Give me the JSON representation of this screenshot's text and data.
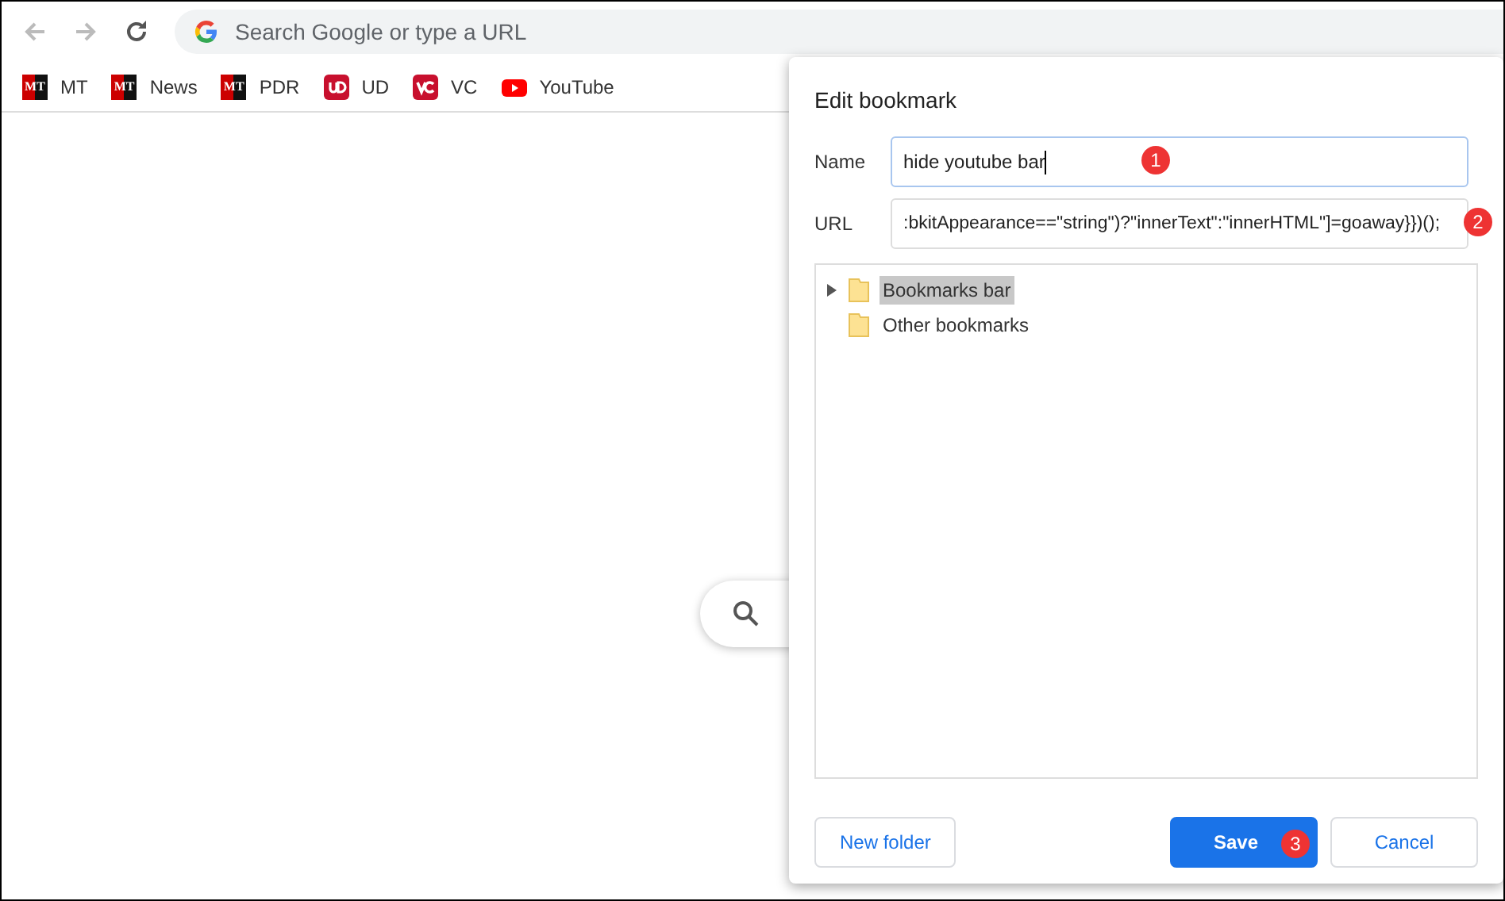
{
  "toolbar": {
    "address_placeholder": "Search Google or type a URL"
  },
  "bookmarks": [
    {
      "label": "MT",
      "kind": "mt",
      "icon_text": "MT"
    },
    {
      "label": "News",
      "kind": "mt",
      "icon_text": "MT"
    },
    {
      "label": "PDR",
      "kind": "mt",
      "icon_text": "MT"
    },
    {
      "label": "UD",
      "kind": "ud"
    },
    {
      "label": "VC",
      "kind": "vc"
    },
    {
      "label": "YouTube",
      "kind": "yt"
    }
  ],
  "dialog": {
    "title": "Edit bookmark",
    "fields": [
      {
        "label": "Name",
        "value": "hide youtube bar",
        "focused": true,
        "marker": "1"
      },
      {
        "label": "URL",
        "value": ":bkitAppearance==\"string\")?\"innerText\":\"innerHTML\"]=goaway}})();",
        "focused": false,
        "marker": "2"
      }
    ],
    "folders": [
      {
        "label": "Bookmarks bar",
        "selected": true,
        "expandable": true
      },
      {
        "label": "Other bookmarks",
        "selected": false,
        "expandable": false
      }
    ],
    "buttons": [
      {
        "label": "New folder",
        "kind": "secondary"
      },
      {
        "label": "Save",
        "kind": "primary",
        "marker": "3"
      },
      {
        "label": "Cancel",
        "kind": "secondary"
      }
    ]
  }
}
